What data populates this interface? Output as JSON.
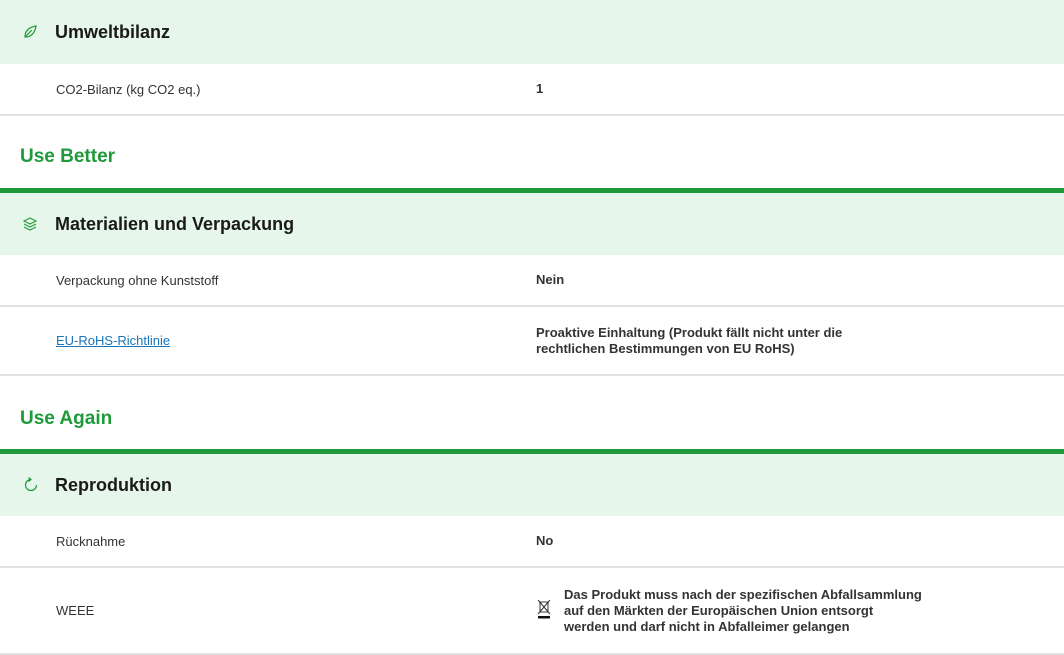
{
  "sections": [
    {
      "id": "umweltbilanz",
      "icon": "leaf-icon",
      "title": "Umweltbilanz",
      "rows": [
        {
          "label": "CO2-Bilanz (kg CO2 eq.)",
          "value": "1"
        }
      ]
    },
    {
      "group_title": "Use Better",
      "id": "materialien",
      "icon": "layers-icon",
      "title": "Materialien und Verpackung",
      "rows": [
        {
          "label": "Verpackung ohne Kunststoff",
          "value": "Nein"
        },
        {
          "label": "EU-RoHS-Richtlinie",
          "value_line1": "Proaktive Einhaltung (Produkt fällt nicht unter die",
          "value_line2": "rechtlichen Bestimmungen von EU RoHS)"
        }
      ]
    },
    {
      "group_title": "Use Again",
      "id": "reproduktion",
      "icon": "recycle-icon",
      "title": "Reproduktion",
      "rows": [
        {
          "label": "Rücknahme",
          "value": "No"
        },
        {
          "label": "WEEE",
          "icon": "crossed-bin-icon",
          "value_line1": "Das Produkt muss nach der spezifischen Abfallsammlung",
          "value_line2": "auf den Märkten der Europäischen Union entsorgt",
          "value_line3": "werden und darf nicht in Abfalleimer gelangen"
        }
      ]
    }
  ],
  "colors": {
    "accent_green": "#1e9a3a",
    "header_bg": "#e7f6ea",
    "link_blue": "#1a75b8"
  }
}
